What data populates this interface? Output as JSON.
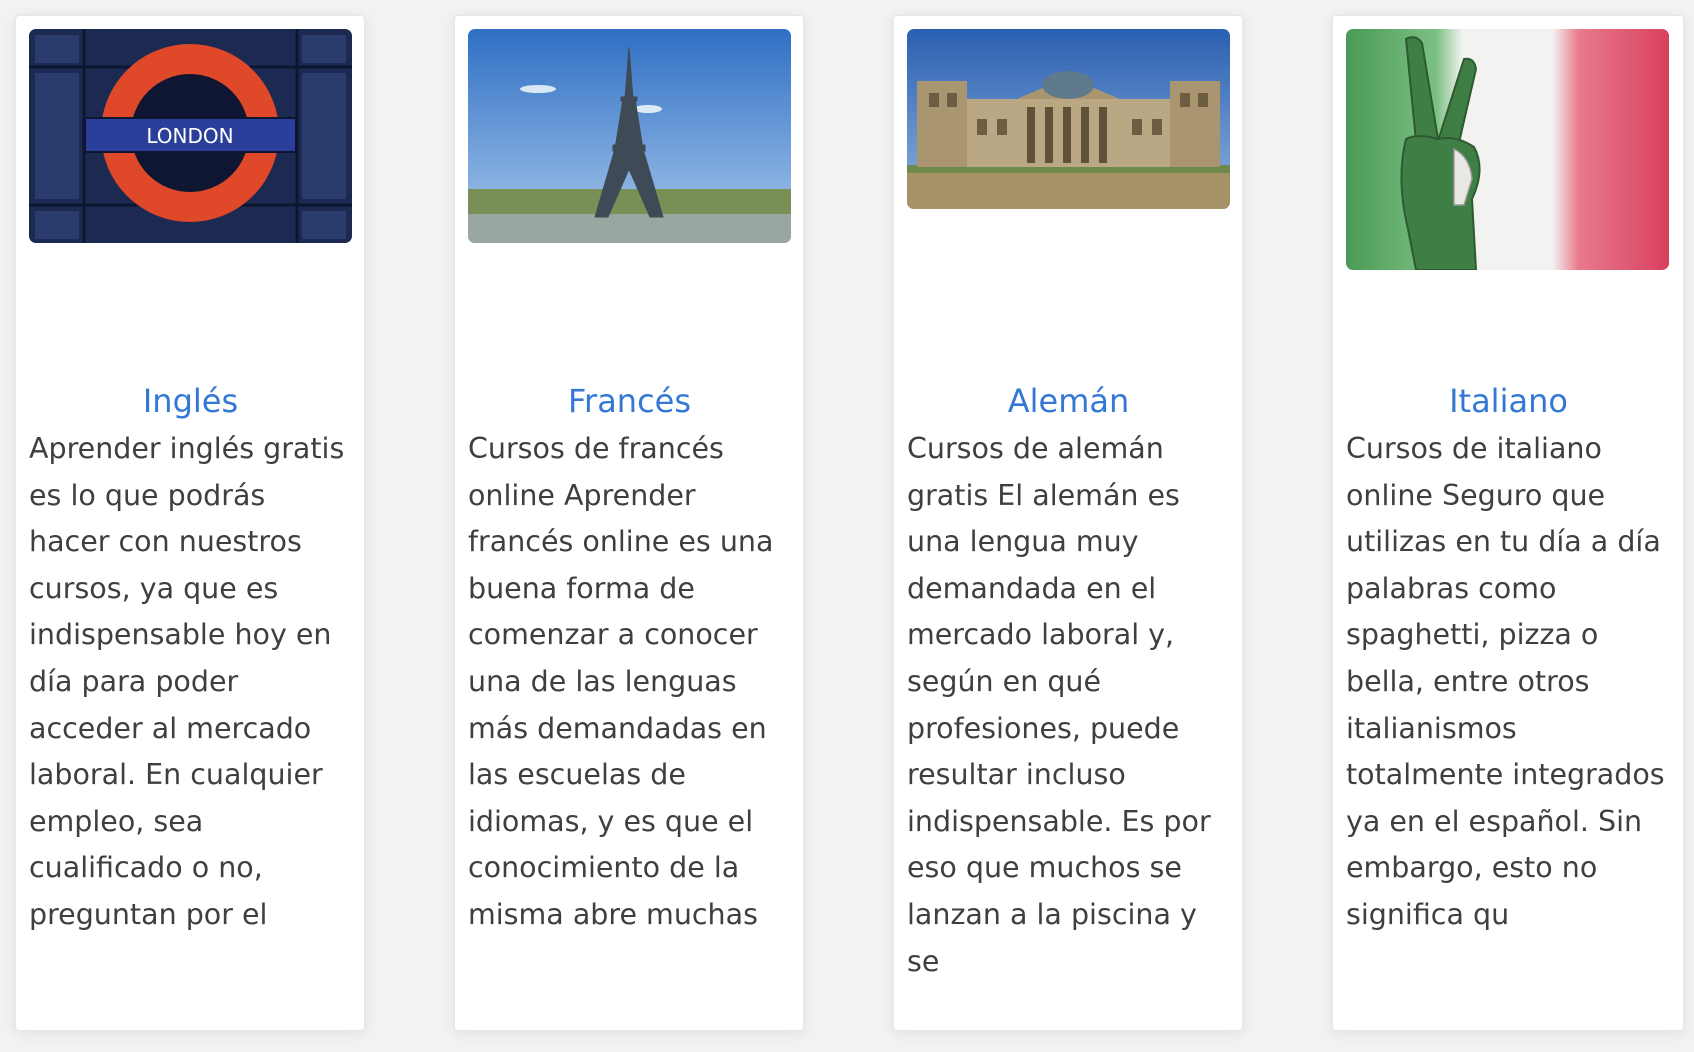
{
  "courses": [
    {
      "title": "Inglés",
      "image_label": "LONDON",
      "description": "Aprender inglés gratis es lo que podrás hacer con nuestros cursos, ya que es indispensable hoy en día para poder acceder al mercado laboral. En cualquier empleo, sea cualificado o no, preguntan por el"
    },
    {
      "title": "Francés",
      "description": "Cursos de francés online Aprender francés online es una buena forma de comenzar a conocer una de las lenguas más demandadas en las escuelas de idiomas, y es que el conocimiento de la misma abre muchas"
    },
    {
      "title": "Alemán",
      "description": "Cursos de alemán gratis El alemán es una lengua muy demandada en el mercado laboral y, según en qué profesiones, puede resultar incluso indispensable. Es por eso que muchos se lanzan a la piscina y se"
    },
    {
      "title": "Italiano",
      "description": "Cursos de italiano online Seguro que utilizas en tu día a día palabras como spaghetti, pizza o bella, entre otros italianismos totalmente integrados ya en el español. Sin embargo, esto no significa qu"
    }
  ],
  "colors": {
    "title": "#3478d6",
    "text": "#3f3f3f",
    "card_bg": "#ffffff",
    "page_bg": "#f2f2f2"
  }
}
